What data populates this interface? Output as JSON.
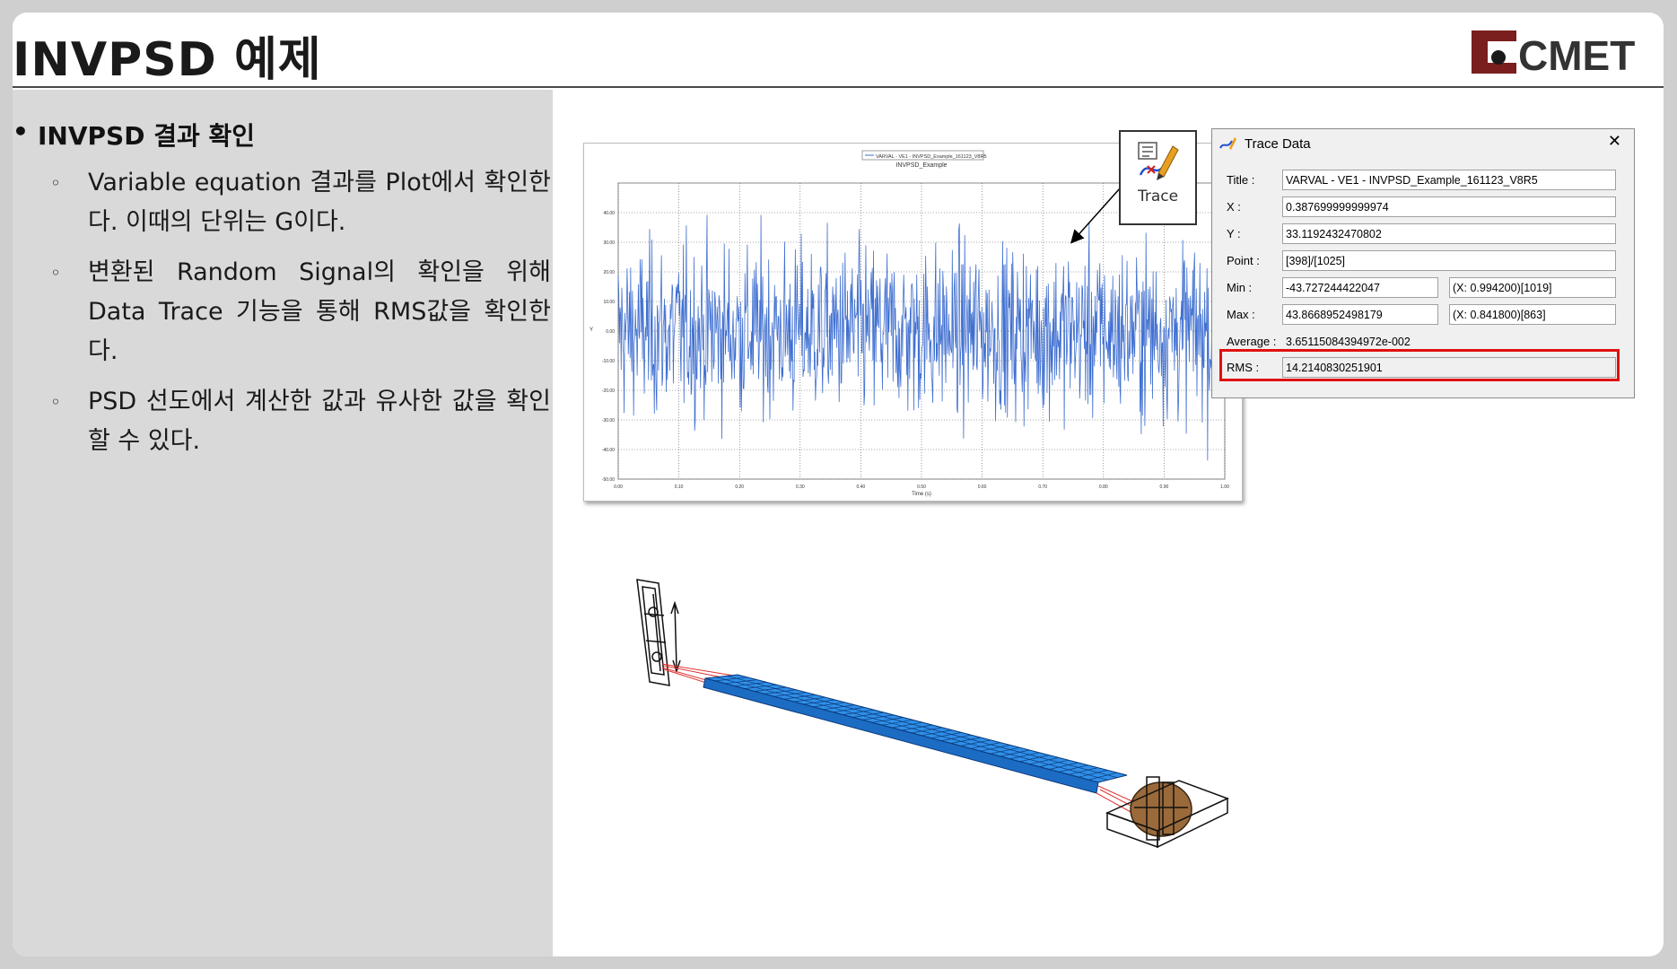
{
  "page": {
    "title": "INVPSD 예제",
    "logo_text": "CMET"
  },
  "bullets": {
    "main": "INVPSD 결과 확인",
    "items": [
      "Variable equation 결과를 Plot에서 확인한다. 이때의 단위는 G이다.",
      "변환된 Random Signal의 확인을 위해 Data Trace 기능을 통해 RMS값을 확인한다.",
      "PSD 선도에서 계산한 값과 유사한 값을 확인할 수 있다."
    ]
  },
  "trace_button": {
    "label": "Trace",
    "icon": "trace-pen-icon"
  },
  "trace_dialog": {
    "title": "Trace Data",
    "close": "✕",
    "rows": [
      {
        "label": "Title :",
        "value": "VARVAL - VE1 - INVPSD_Example_161123_V8R5"
      },
      {
        "label": "X :",
        "value": "0.387699999999974"
      },
      {
        "label": "Y :",
        "value": "33.1192432470802"
      },
      {
        "label": "Point :",
        "value": "[398]/[1025]"
      },
      {
        "label": "Min :",
        "value": "-43.727244422047",
        "extra": "(X: 0.994200)[1019]"
      },
      {
        "label": "Max :",
        "value": "43.8668952498179",
        "extra": "(X: 0.841800)[863]"
      },
      {
        "label": "Average :",
        "value": "3.65115084394972e-002"
      },
      {
        "label": "RMS :",
        "value": "14.2140830251901"
      }
    ]
  },
  "chart_data": {
    "type": "line",
    "title": "INVPSD_Example",
    "legend": "VARVAL - VE1 - INVPSD_Example_161123_V8R5",
    "xlabel": "Time (s)",
    "ylabel": "Y",
    "xlim": [
      0,
      1
    ],
    "ylim": [
      -50,
      50
    ],
    "xticks": [
      "0.00",
      "0.10",
      "0.20",
      "0.30",
      "0.40",
      "0.50",
      "0.60",
      "0.70",
      "0.80",
      "0.90",
      "1.00"
    ],
    "yticks": [
      "40.00",
      "30.00",
      "20.00",
      "10.00",
      "0.00",
      "-10.00",
      "-20.00",
      "-30.00",
      "-40.00",
      "-50.00"
    ],
    "grid": true,
    "series_color": "#3f6fd0",
    "num_points": 1025,
    "rms": 14.2140830251901,
    "min": -43.727244422047,
    "max": 43.8668952498179
  },
  "colors": {
    "accent_red": "#e01010",
    "beam_blue": "#2f8fe8",
    "left_panel": "#d9d9d9"
  }
}
